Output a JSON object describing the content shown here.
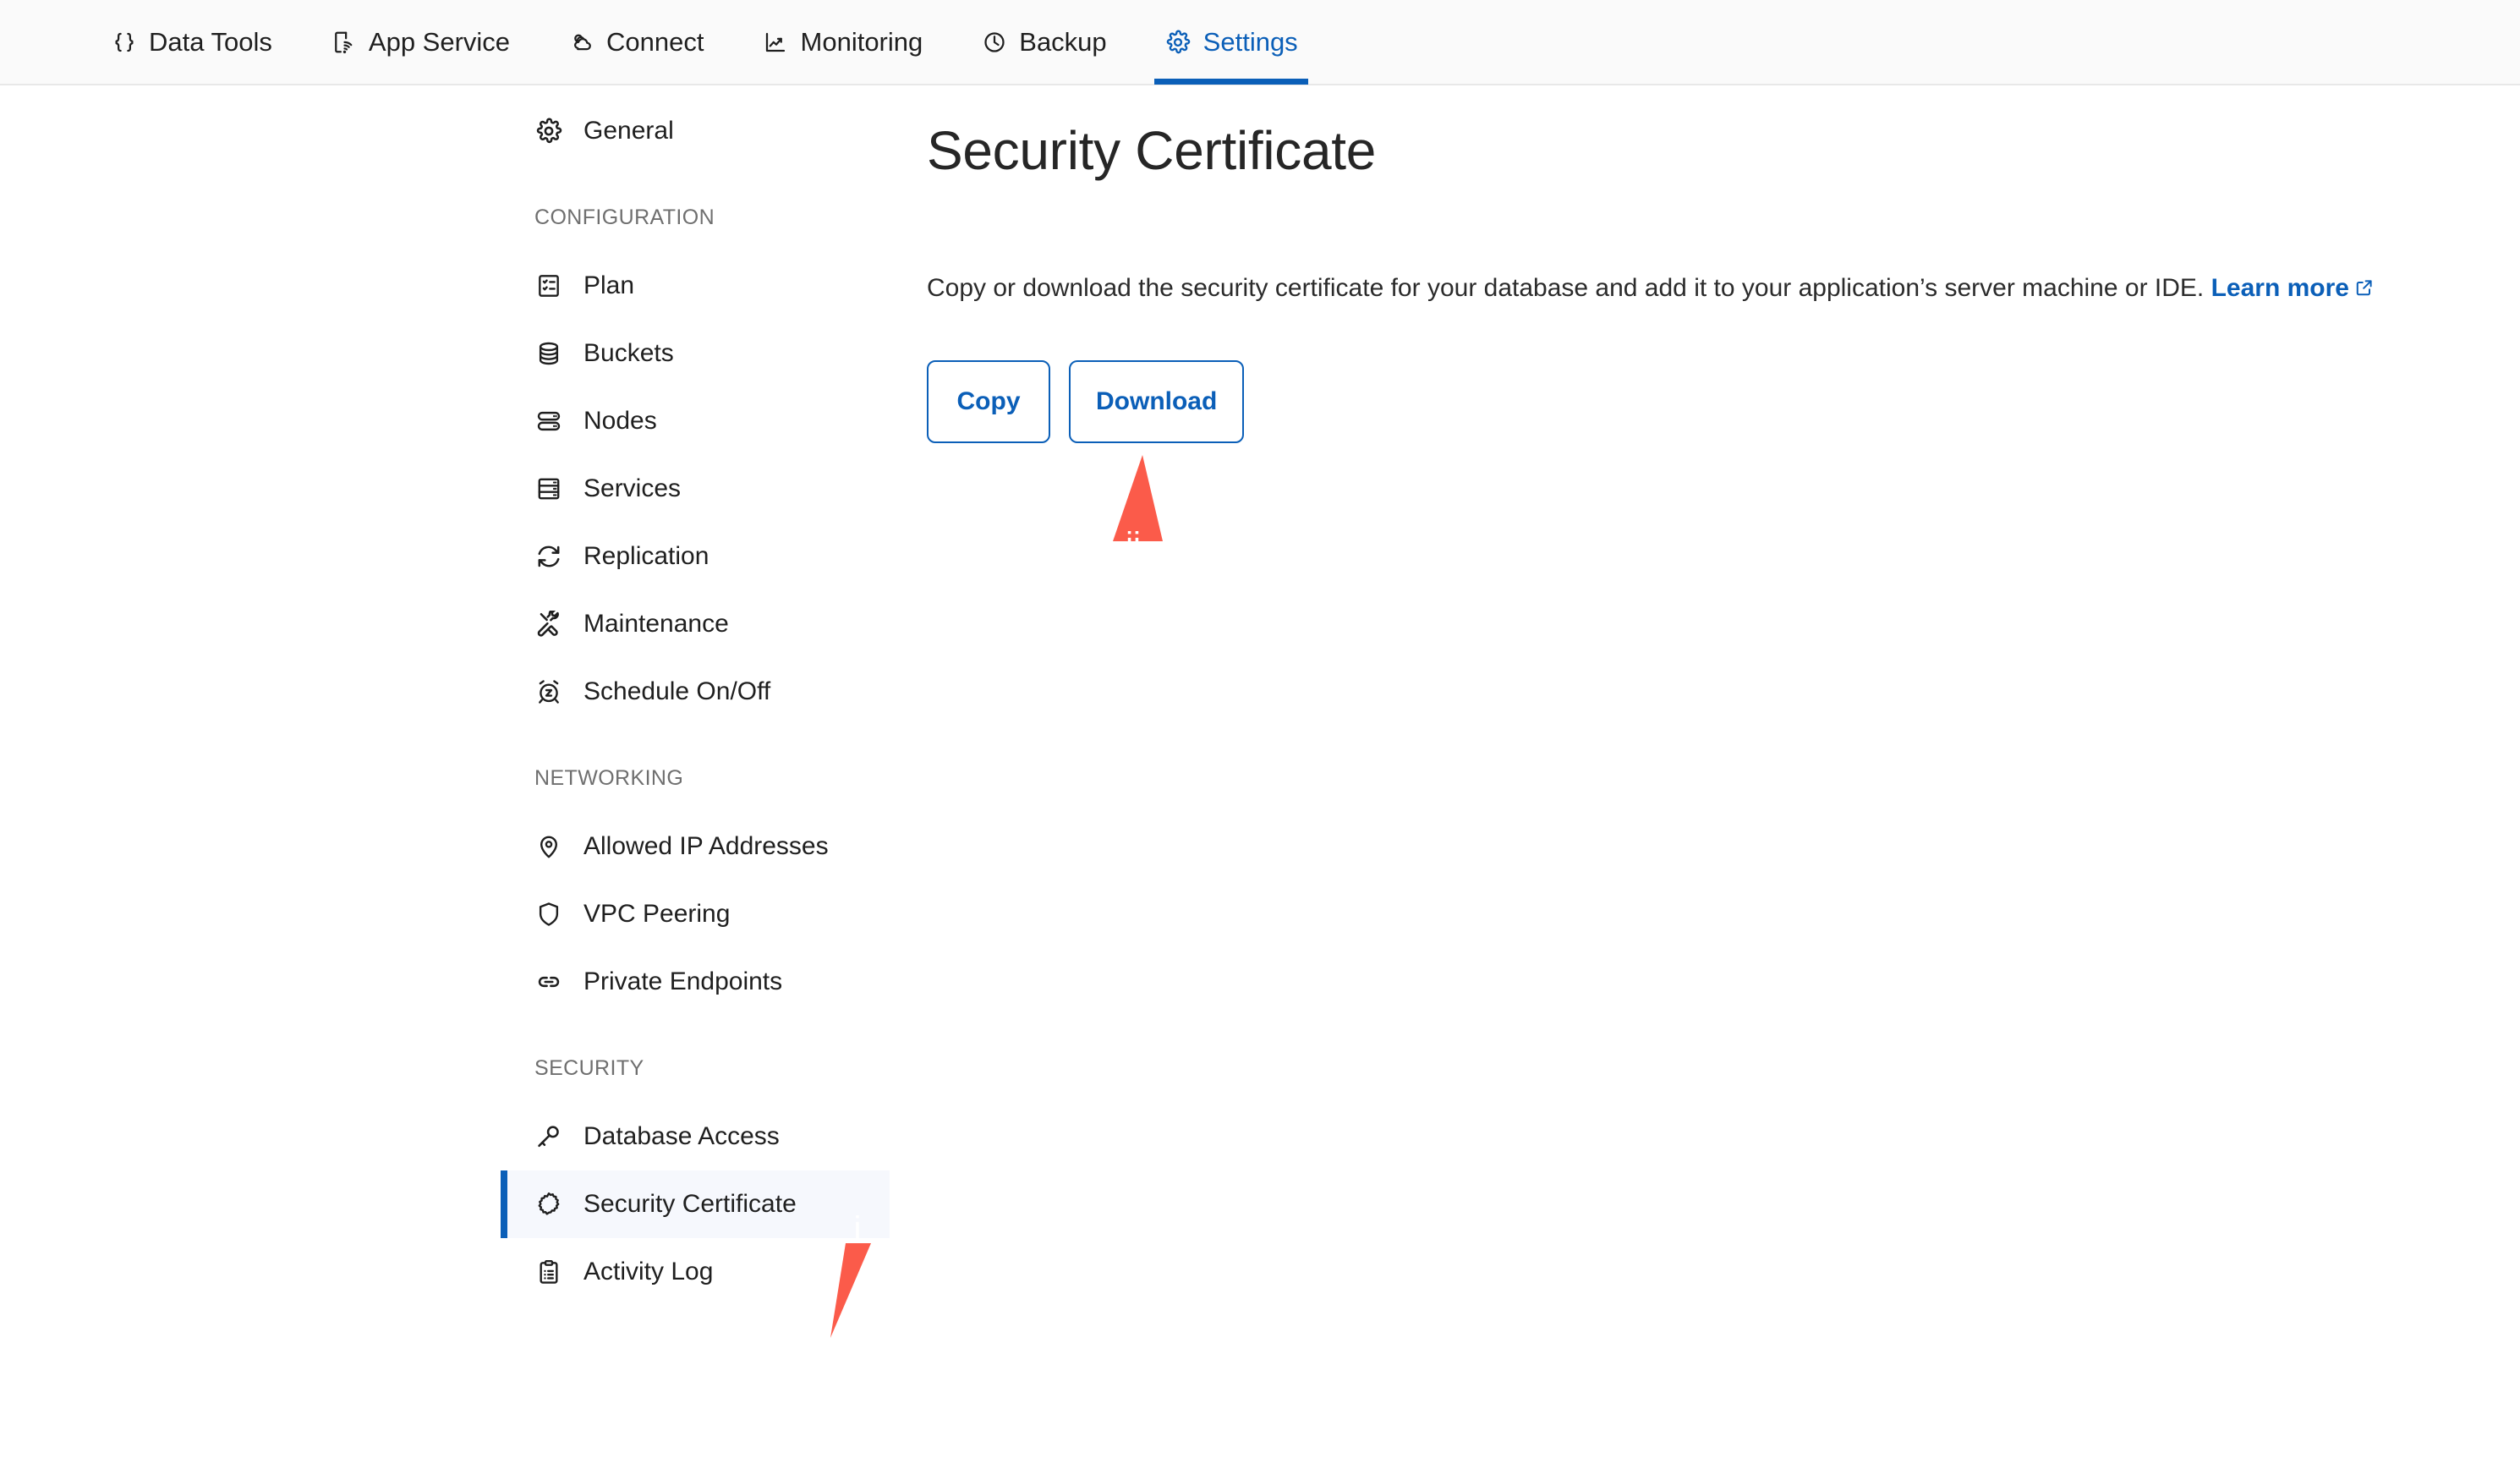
{
  "topnav": {
    "tabs": [
      {
        "label": "Data Tools",
        "icon": "braces-icon",
        "active": false
      },
      {
        "label": "App Service",
        "icon": "device-wifi-icon",
        "active": false
      },
      {
        "label": "Connect",
        "icon": "clouds-icon",
        "active": false
      },
      {
        "label": "Monitoring",
        "icon": "chart-line-icon",
        "active": false
      },
      {
        "label": "Backup",
        "icon": "clock-icon",
        "active": false
      },
      {
        "label": "Settings",
        "icon": "gear-icon",
        "active": true
      }
    ],
    "active_color": "#0b5fb8"
  },
  "sidebar": {
    "top_items": [
      {
        "label": "General",
        "icon": "gear-icon"
      }
    ],
    "groups": [
      {
        "label": "CONFIGURATION",
        "items": [
          {
            "label": "Plan",
            "icon": "list-checklist-icon"
          },
          {
            "label": "Buckets",
            "icon": "database-icon"
          },
          {
            "label": "Nodes",
            "icon": "server-stack-icon"
          },
          {
            "label": "Services",
            "icon": "server-rack-icon"
          },
          {
            "label": "Replication",
            "icon": "refresh-sync-icon"
          },
          {
            "label": "Maintenance",
            "icon": "tools-icon"
          },
          {
            "label": "Schedule On/Off",
            "icon": "alarm-snooze-icon"
          }
        ]
      },
      {
        "label": "NETWORKING",
        "items": [
          {
            "label": "Allowed IP Addresses",
            "icon": "map-pin-icon"
          },
          {
            "label": "VPC Peering",
            "icon": "shield-icon"
          },
          {
            "label": "Private Endpoints",
            "icon": "link-icon"
          }
        ]
      },
      {
        "label": "SECURITY",
        "items": [
          {
            "label": "Database Access",
            "icon": "key-icon"
          },
          {
            "label": "Security Certificate",
            "icon": "certificate-seal-icon",
            "active": true
          },
          {
            "label": "Activity Log",
            "icon": "clipboard-list-icon"
          }
        ]
      }
    ],
    "active_item": "Security Certificate",
    "active_bar_color": "#0b5fb8",
    "active_bg_color": "#f6f8fd"
  },
  "main": {
    "title": "Security Certificate",
    "description_before_link": "Copy or download the security certificate for your database and add it to your application’s server machine or IDE.",
    "learn_more_label": "Learn more",
    "buttons": [
      {
        "label": "Copy",
        "name": "copy-button"
      },
      {
        "label": "Download",
        "name": "download-button"
      }
    ]
  },
  "annotations": {
    "color": "#fb5b4a",
    "markers": [
      {
        "id": "i",
        "label": "i",
        "target": "sidebar-item-security-certificate"
      },
      {
        "id": "ii",
        "label": "ii",
        "target": "download-button"
      }
    ]
  }
}
